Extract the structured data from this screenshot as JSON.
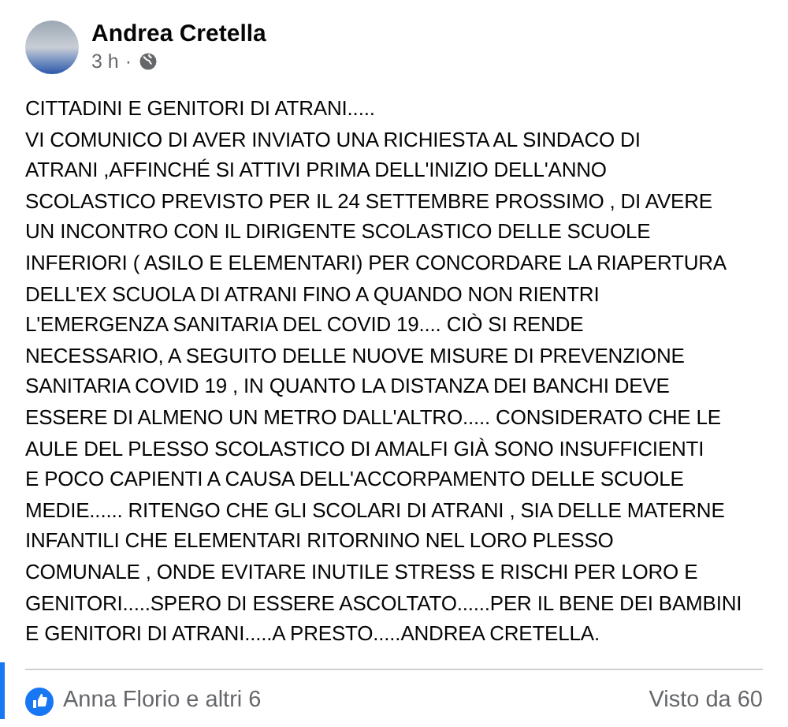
{
  "post": {
    "author": "Andrea Cretella",
    "time": "3 h",
    "separator": "·",
    "body_lines": [
      "CITTADINI E GENITORI DI ATRANI.....",
      "VI COMUNICO DI AVER INVIATO UNA RICHIESTA AL SINDACO DI",
      "ATRANI ,AFFINCHÉ SI ATTIVI PRIMA DELL'INIZIO DELL'ANNO",
      "SCOLASTICO PREVISTO PER IL 24 SETTEMBRE PROSSIMO , DI AVERE",
      "UN INCONTRO CON IL DIRIGENTE SCOLASTICO DELLE SCUOLE",
      "INFERIORI ( ASILO E ELEMENTARI) PER CONCORDARE LA RIAPERTURA",
      "DELL'EX SCUOLA DI ATRANI  FINO A QUANDO NON RIENTRI",
      "L'EMERGENZA SANITARIA DEL COVID 19.... CIÒ SI RENDE",
      "NECESSARIO, A SEGUITO DELLE NUOVE MISURE DI PREVENZIONE",
      "SANITARIA COVID 19 , IN QUANTO LA DISTANZA DEI BANCHI DEVE",
      "ESSERE DI ALMENO UN METRO DALL'ALTRO.....  CONSIDERATO CHE LE",
      "AULE  DEL PLESSO SCOLASTICO DI AMALFI GIÀ SONO INSUFFICIENTI",
      "E POCO CAPIENTI A CAUSA DELL'ACCORPAMENTO DELLE SCUOLE",
      "MEDIE...... RITENGO CHE GLI SCOLARI DI ATRANI , SIA DELLE MATERNE",
      "INFANTILI CHE ELEMENTARI RITORNINO NEL LORO PLESSO",
      "COMUNALE , ONDE EVITARE INUTILE STRESS E RISCHI PER LORO E",
      "GENITORI.....SPERO DI ESSERE ASCOLTATO......PER IL BENE DEI BAMBINI",
      "E GENITORI DI ATRANI.....A PRESTO.....ANDREA CRETELLA."
    ],
    "reactions": "Anna Florio e altri 6",
    "views": "Visto da 60"
  }
}
